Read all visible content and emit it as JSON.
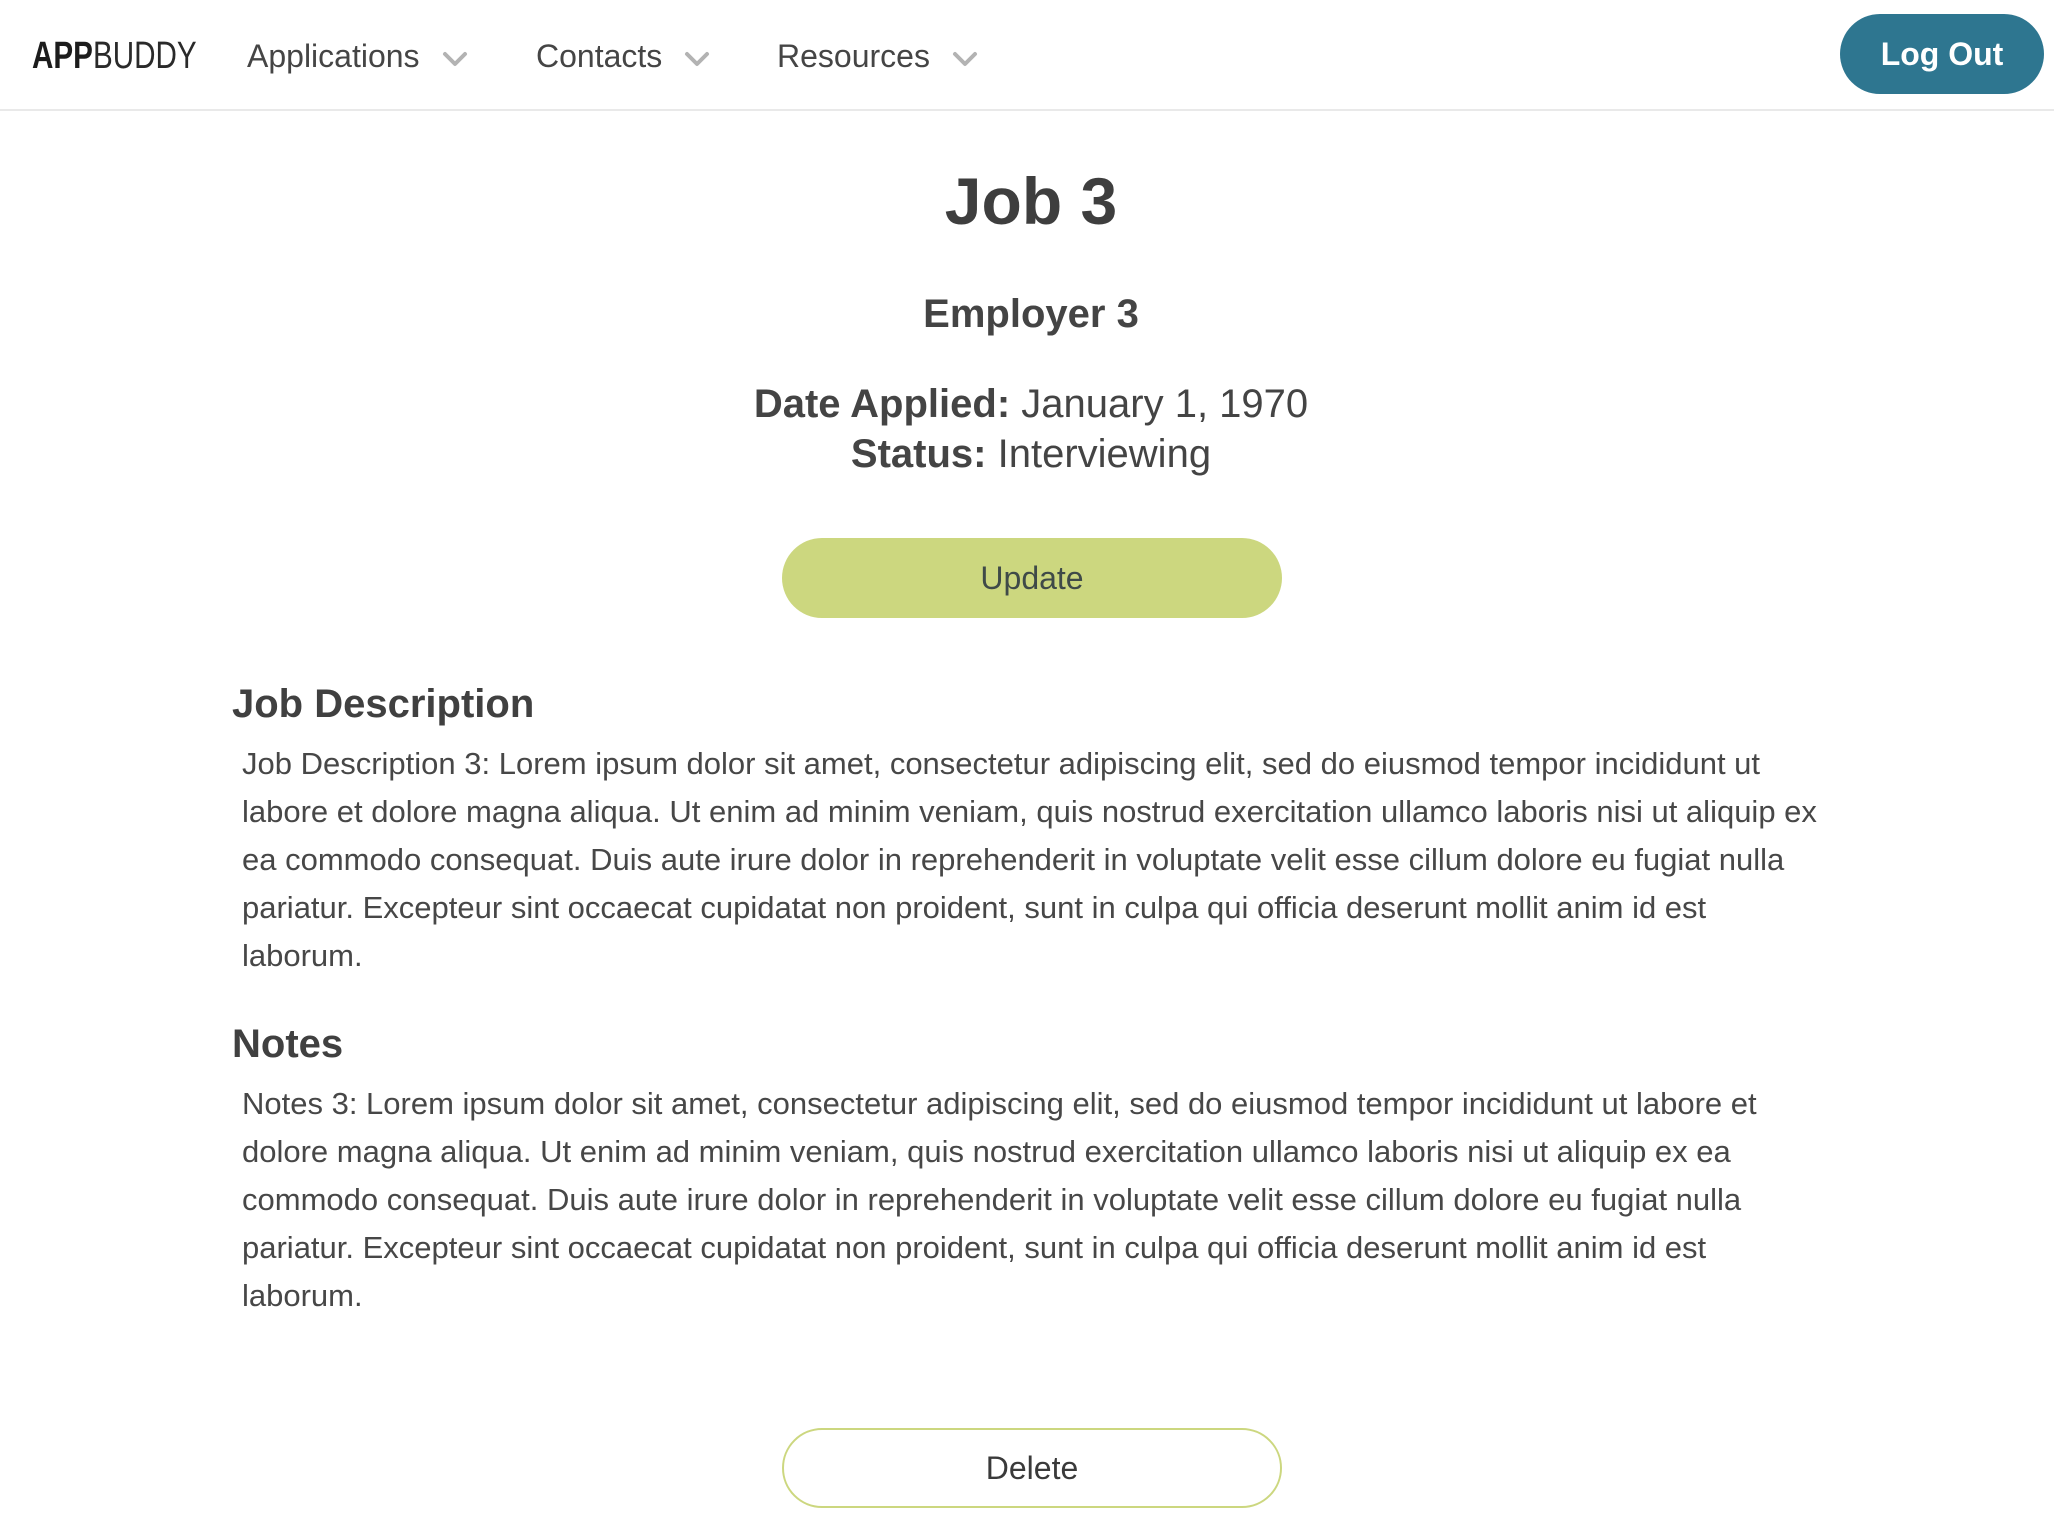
{
  "nav": {
    "logo_bold": "APP",
    "logo_light": "BUDDY",
    "items": [
      {
        "label": "Applications",
        "icon": "chevron-down-icon"
      },
      {
        "label": "Contacts",
        "icon": "chevron-down-icon"
      },
      {
        "label": "Resources",
        "icon": "chevron-down-icon"
      }
    ],
    "logout_label": "Log Out"
  },
  "job": {
    "title": "Job 3",
    "employer": "Employer 3",
    "date_applied_label": "Date Applied:",
    "date_applied_value": "January 1, 1970",
    "status_label": "Status:",
    "status_value": "Interviewing"
  },
  "actions": {
    "update_label": "Update",
    "delete_label": "Delete"
  },
  "sections": {
    "description_heading": "Job Description",
    "description_text": "Job Description 3: Lorem ipsum dolor sit amet, consectetur adipiscing elit, sed do eiusmod tempor incididunt ut labore et dolore magna aliqua. Ut enim ad minim veniam, quis nostrud exercitation ullamco laboris nisi ut aliquip ex ea commodo consequat. Duis aute irure dolor in reprehenderit in voluptate velit esse cillum dolore eu fugiat nulla pariatur. Excepteur sint occaecat cupidatat non proident, sunt in culpa qui officia deserunt mollit anim id est laborum.",
    "notes_heading": "Notes",
    "notes_text": "Notes 3: Lorem ipsum dolor sit amet, consectetur adipiscing elit, sed do eiusmod tempor incididunt ut labore et dolore magna aliqua. Ut enim ad minim veniam, quis nostrud exercitation ullamco laboris nisi ut aliquip ex ea commodo consequat. Duis aute irure dolor in reprehenderit in voluptate velit esse cillum dolore eu fugiat nulla pariatur. Excepteur sint occaecat cupidatat non proident, sunt in culpa qui officia deserunt mollit anim id est laborum."
  },
  "colors": {
    "logout_bg": "#2e7690",
    "update_bg": "#ccd77f",
    "delete_border": "#ccd77f",
    "text": "#464646"
  }
}
